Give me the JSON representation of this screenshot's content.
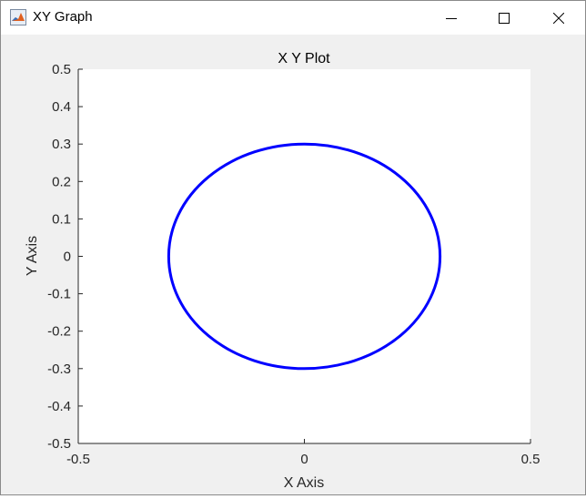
{
  "window": {
    "title": "XY Graph",
    "icons": {
      "app": "matlab-icon",
      "minimize": "minimize-icon",
      "maximize": "maximize-icon",
      "close": "close-icon"
    }
  },
  "chart_data": {
    "type": "line",
    "title": "X Y Plot",
    "xlabel": "X Axis",
    "ylabel": "Y Axis",
    "xlim": [
      -0.5,
      0.5
    ],
    "ylim": [
      -0.5,
      0.5
    ],
    "xticks": [
      "-0.5",
      "0",
      "0.5"
    ],
    "yticks": [
      "0.5",
      "0.4",
      "0.3",
      "0.2",
      "0.1",
      "0",
      "-0.1",
      "-0.2",
      "-0.3",
      "-0.4",
      "-0.5"
    ],
    "grid": false,
    "series": [
      {
        "shape": "circle",
        "center": [
          0,
          0
        ],
        "radius": 0.3,
        "color": "#0000ff"
      }
    ],
    "colors": {
      "plot_background": "#ffffff",
      "figure_background": "#f0f0f0",
      "line": "#0000ff"
    }
  }
}
